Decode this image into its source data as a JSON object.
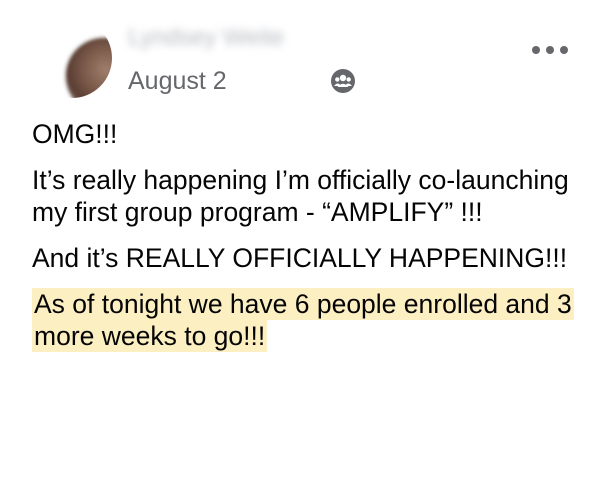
{
  "post": {
    "author_name": "Lyndsey Weite",
    "date": "August 2",
    "paragraphs": [
      "OMG!!!",
      "It’s really happening I’m officially co-launching my first group program - “AMPLIFY” !!!",
      "And it’s REALLY OFFICIALLY HAPPENING!!!"
    ],
    "highlighted_paragraph": "As of tonight we have 6 people enrolled and 3 more weeks to go!!!"
  },
  "icons": {
    "audience": "group-audience-icon",
    "more": "more-options-icon"
  },
  "colors": {
    "text": "#050505",
    "secondary_text": "#65676b",
    "highlight": "#fcefc2"
  }
}
